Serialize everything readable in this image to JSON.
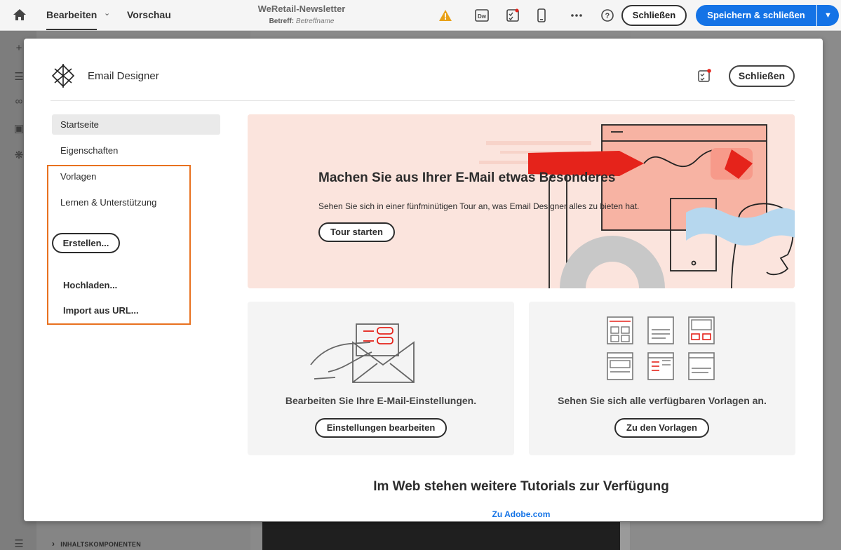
{
  "topbar": {
    "tab_edit": "Bearbeiten",
    "tab_preview": "Vorschau",
    "doc_title": "WeRetail-Newsletter",
    "subject_label": "Betreff:",
    "subject_placeholder": "Betreffname",
    "close_label": "Schließen",
    "save_close_label": "Speichern & schließen"
  },
  "leftpanel": {
    "content_components": "INHALTSKOMPONENTEN"
  },
  "modal": {
    "title": "Email Designer",
    "close_label": "Schließen",
    "nav": {
      "home": "Startseite",
      "properties": "Eigenschaften",
      "templates": "Vorlagen",
      "learn_support": "Lernen & Unterstützung",
      "create": "Erstellen...",
      "upload": "Hochladen...",
      "import_url": "Import aus URL..."
    },
    "hero": {
      "title": "Machen Sie aus Ihrer E-Mail etwas Besonderes",
      "subtitle": "Sehen Sie sich in einer fünfminütigen Tour an, was Email Designer alles zu bieten hat.",
      "tour_button": "Tour starten"
    },
    "cards": [
      {
        "text": "Bearbeiten Sie Ihre E-Mail-Einstellungen.",
        "button": "Einstellungen bearbeiten"
      },
      {
        "text": "Sehen Sie sich alle verfügbaren Vorlagen an.",
        "button": "Zu den Vorlagen"
      }
    ],
    "web_title": "Im Web stehen weitere Tutorials zur Verfügung",
    "web_link": "Zu Adobe.com"
  },
  "colors": {
    "accent_blue": "#1473e6",
    "highlight_orange": "#e8711f",
    "hero_bg": "#fbe4dd",
    "illustration_red": "#e5231b",
    "warning": "#e8a118"
  }
}
